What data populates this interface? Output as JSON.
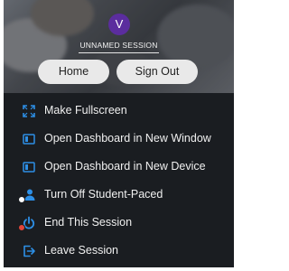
{
  "session": {
    "avatar_initial": "V",
    "name": "UNNAMED SESSION"
  },
  "buttons": {
    "home": "Home",
    "sign_out": "Sign Out"
  },
  "menu": [
    {
      "label": "Make Fullscreen",
      "icon": "fullscreen-icon"
    },
    {
      "label": "Open Dashboard in New Window",
      "icon": "dashboard-window-icon"
    },
    {
      "label": "Open Dashboard in New Device",
      "icon": "dashboard-device-icon"
    },
    {
      "label": "Turn Off Student-Paced",
      "icon": "student-paced-icon"
    },
    {
      "label": "End This Session",
      "icon": "power-icon"
    },
    {
      "label": "Leave Session",
      "icon": "leave-session-icon"
    }
  ],
  "colors": {
    "accent": "#2d8fe6",
    "avatar": "#5b2d9e",
    "panel_bg": "#1a1d21",
    "status_red": "#e0453a"
  }
}
